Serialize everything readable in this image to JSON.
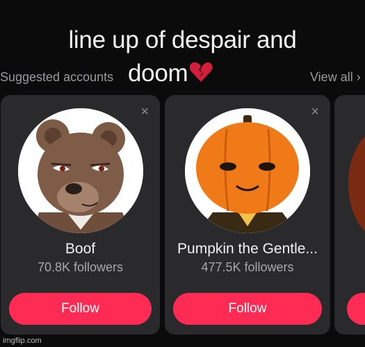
{
  "caption": {
    "line1": "line up of despair and",
    "line2": "doom"
  },
  "header": {
    "suggested": "Suggested accounts",
    "view_all": "View all"
  },
  "cards": [
    {
      "name": "Boof",
      "followers": "70.8K followers",
      "follow": "Follow",
      "close": "×"
    },
    {
      "name": "Pumpkin the Gentle...",
      "followers": "477.5K followers",
      "follow": "Follow",
      "close": "×"
    }
  ],
  "watermark": "imgflip.com",
  "colors": {
    "follow_button": "#fe2c55",
    "card_bg": "#2a2a2c",
    "page_bg": "#0b0b0c",
    "heart": "#d21f3c"
  }
}
